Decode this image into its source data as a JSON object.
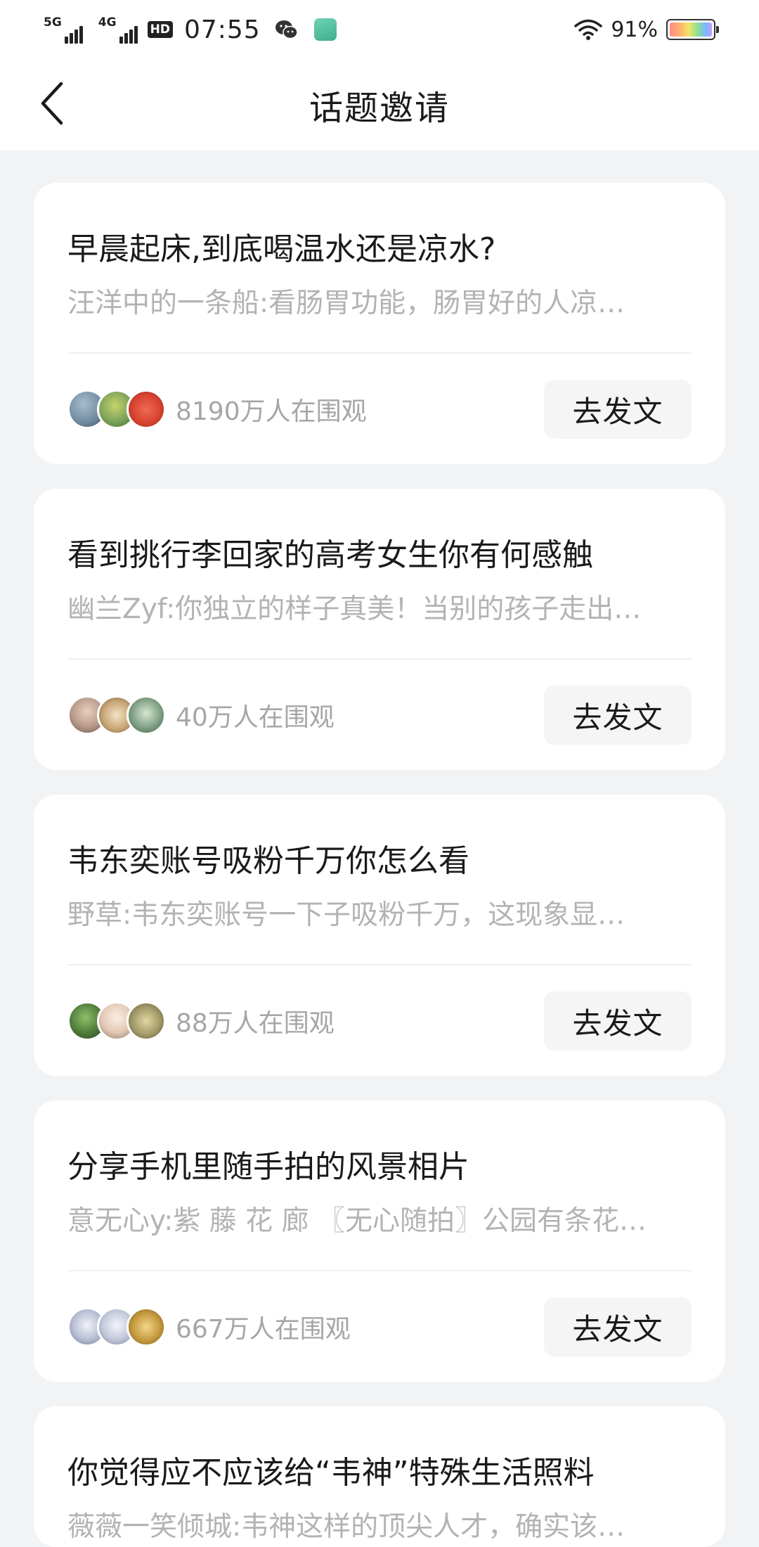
{
  "status_bar": {
    "sim1": "5G",
    "sim2": "4G",
    "hd": "HD",
    "time": "07:55",
    "battery_percent": "91%"
  },
  "nav": {
    "title": "话题邀请"
  },
  "topics": [
    {
      "title": "早晨起床,到底喝温水还是凉水?",
      "snippet": "汪洋中的一条船:看肠胃功能，肠胃好的人凉…",
      "viewers": "8190万人在围观",
      "button": "去发文",
      "avatars": [
        "#6f8aa0",
        "#7da35a",
        "#d84532"
      ]
    },
    {
      "title": "看到挑行李回家的高考女生你有何感触",
      "snippet": "幽兰Zyf:你独立的样子真美！当别的孩子走出…",
      "viewers": "40万人在围观",
      "button": "去发文",
      "avatars": [
        "#b99a8a",
        "#c9a778",
        "#7fa084"
      ]
    },
    {
      "title": "韦东奕账号吸粉千万你怎么看",
      "snippet": "野草:韦东奕账号一下子吸粉千万，这现象显…",
      "viewers": "88万人在围观",
      "button": "去发文",
      "avatars": [
        "#4f7a3a",
        "#e2c9b5",
        "#a39a6a"
      ]
    },
    {
      "title": "分享手机里随手拍的风景相片",
      "snippet": "意无心y:紫 藤 花 廊 〖无心随拍〗公园有条花…",
      "viewers": "667万人在围观",
      "button": "去发文",
      "avatars": [
        "#b8bfd4",
        "#c3c8db",
        "#c49a3e"
      ]
    },
    {
      "title": "你觉得应不应该给“韦神”特殊生活照料",
      "snippet": "薇薇一笑倾城:韦神这样的顶尖人才，确实该…"
    }
  ]
}
